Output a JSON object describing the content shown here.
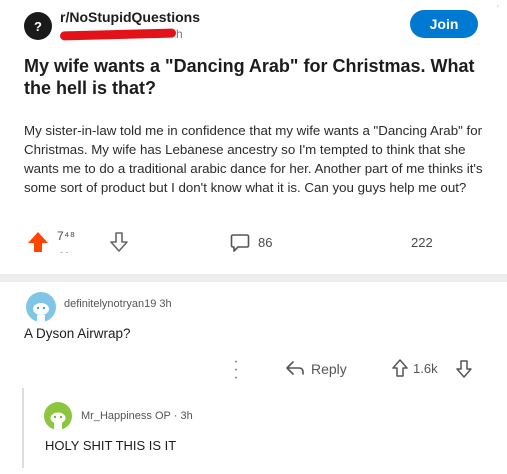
{
  "subreddit": {
    "name": "r/NoStupidQuestions",
    "avatar_glyph": "?",
    "meta_fragment": "h",
    "join_label": "Join"
  },
  "post": {
    "title": "My wife wants a \"Dancing Arab\" for Christmas. What the hell is that?",
    "body": "My sister-in-law told me in confidence that my wife wants a \"Dancing Arab\" for Christmas. My wife has Lebanese ancestry so I'm tempted to think that she wants me to do a traditional arabic dance for her. Another part of me thinks it's some sort of product but I don't know what it is. Can you guys help me out?",
    "vote_count": "7⁴⁸",
    "vote_smudge": "- -",
    "comment_count": "86",
    "share_count": "222"
  },
  "comments": [
    {
      "username": "definitelynotryan19",
      "age": "3h",
      "text": "A Dyson Airwrap?",
      "reply_label": "Reply",
      "score": "1.6k"
    },
    {
      "username": "Mr_Happiness",
      "op_badge": "OP",
      "age": "3h",
      "text": "HOLY SHIT THIS IS IT"
    }
  ],
  "colors": {
    "upvote": "#ff4500",
    "join_button": "#0079d3",
    "redaction": "#e3121a",
    "avatar_1": "#7fc6e6",
    "avatar_2": "#8cc63f"
  },
  "icons": {
    "subreddit_avatar": "subreddit-avatar-icon",
    "upvote": "upvote-arrow-icon",
    "downvote": "downvote-arrow-icon",
    "comment": "comment-bubble-icon",
    "more": "more-dots-icon",
    "reply": "reply-arrow-icon"
  }
}
